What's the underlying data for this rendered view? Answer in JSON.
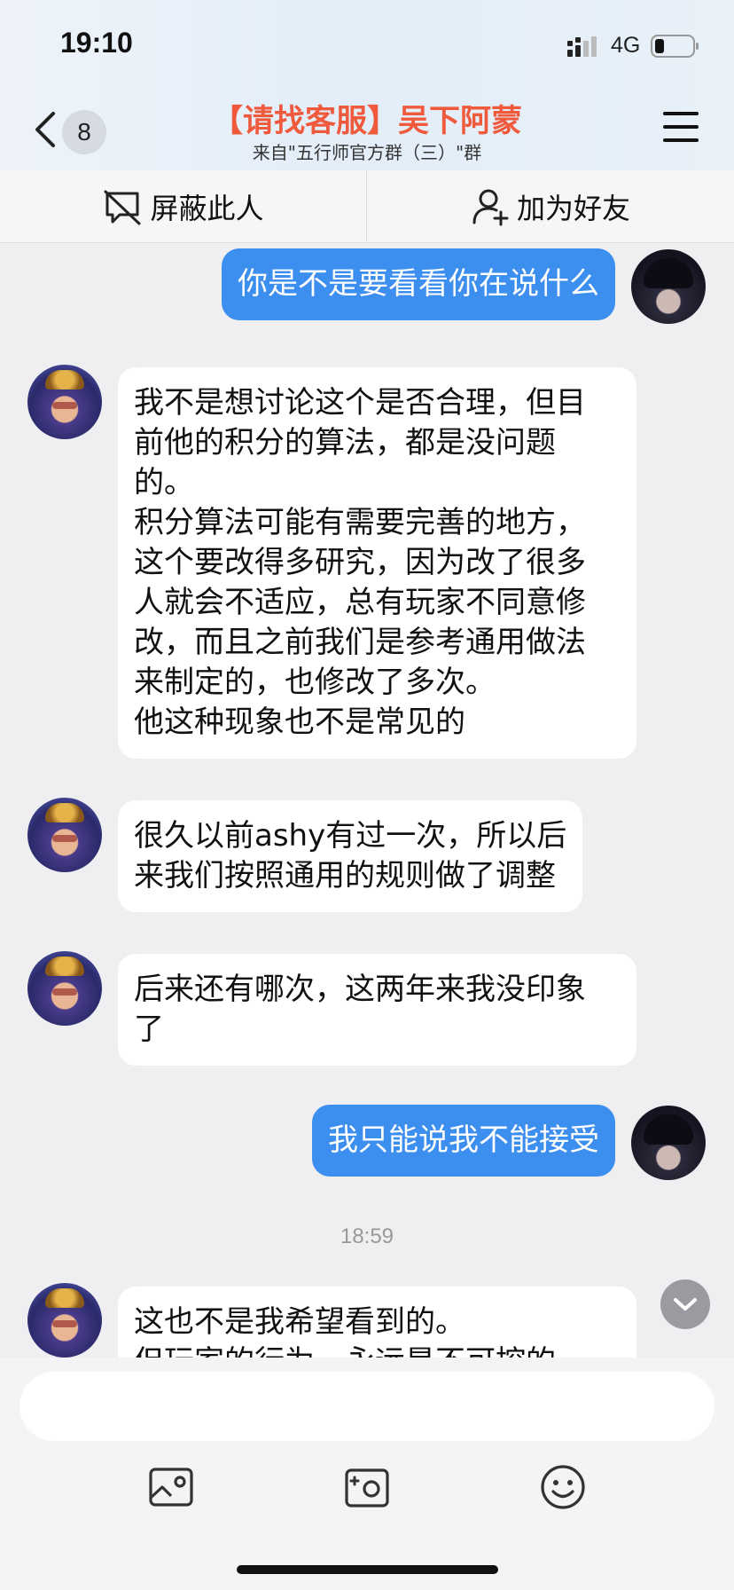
{
  "status_bar": {
    "time": "19:10",
    "network": "4G",
    "battery_level": 0.25
  },
  "header": {
    "unread_count": "8",
    "title": "【请找客服】吴下阿蒙",
    "subtitle": "来自\"五行师官方群（三）\"群",
    "title_color": "#ef5a3c"
  },
  "actions": {
    "block_label": "屏蔽此人",
    "add_friend_label": "加为好友"
  },
  "messages": [
    {
      "sender": "me",
      "text": "你是不是要看看你在说什么"
    },
    {
      "sender": "other",
      "text": "我不是想讨论这个是否合理，但目\n前他的积分的算法，都是没问题\n的。\n积分算法可能有需要完善的地方，\n这个要改得多研究，因为改了很多\n人就会不适应，总有玩家不同意修\n改，而且之前我们是参考通用做法\n来制定的，也修改了多次。\n他这种现象也不是常见的"
    },
    {
      "sender": "other",
      "text": "很久以前ashy有过一次，所以后\n来我们按照通用的规则做了调整"
    },
    {
      "sender": "other",
      "text": "后来还有哪次，这两年来我没印象\n了"
    },
    {
      "sender": "me",
      "text": "我只能说我不能接受"
    },
    {
      "sender": "other",
      "text": "这也不是我希望看到的。\n但玩家的行为，永远是不可控的"
    }
  ],
  "timestamp": "18:59",
  "colors": {
    "my_bubble": "#3c8eef",
    "other_bubble": "#ffffff",
    "background": "#efeff1"
  },
  "input": {
    "placeholder": ""
  },
  "toolbar": [
    "photo-icon",
    "camera-icon",
    "emoji-icon"
  ]
}
